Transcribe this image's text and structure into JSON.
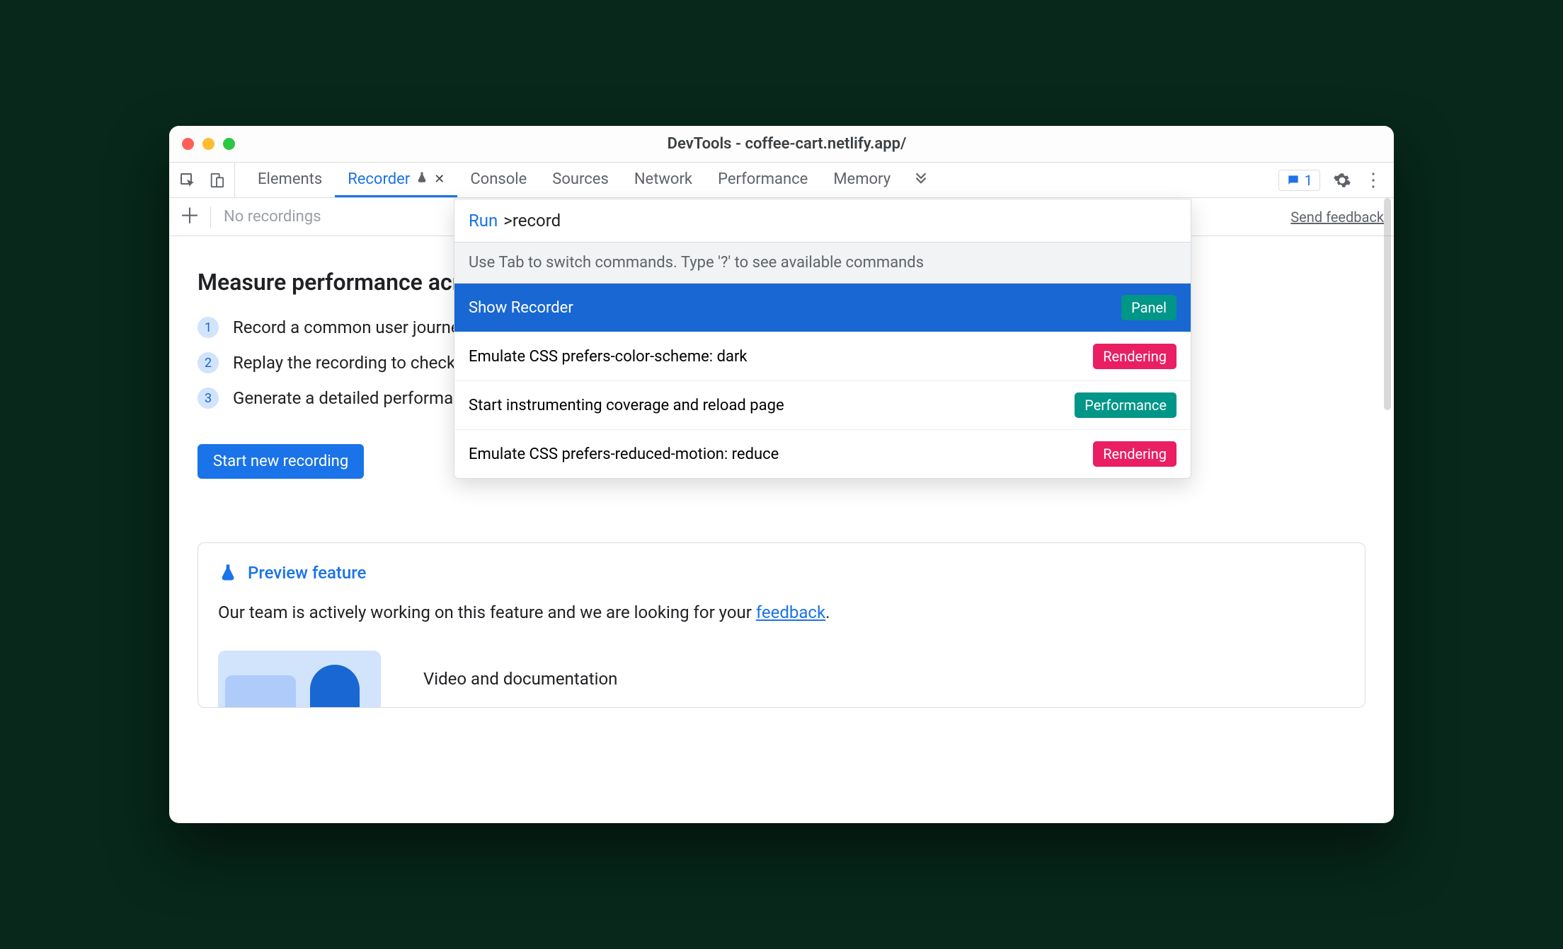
{
  "window": {
    "title": "DevTools - coffee-cart.netlify.app/"
  },
  "tabs": {
    "list": [
      "Elements",
      "Recorder",
      "Console",
      "Sources",
      "Network",
      "Performance",
      "Memory"
    ],
    "active_index": 1
  },
  "message_count": "1",
  "subbar": {
    "placeholder": "No recordings",
    "feedback": "Send feedback"
  },
  "content": {
    "heading": "Measure performance across an entire user journey",
    "steps": [
      "Record a common user journey on your website or app",
      "Replay the recording to check it works",
      "Generate a detailed performance trace"
    ],
    "button": "Start new recording"
  },
  "preview": {
    "title": "Preview feature",
    "body_prefix": "Our team is actively working on this feature and we are looking for your ",
    "feedback_word": "feedback",
    "body_suffix": ".",
    "media_label": "Video and documentation"
  },
  "command_menu": {
    "run_label": "Run",
    "query": ">record",
    "hint": "Use Tab to switch commands. Type '?' to see available commands",
    "rows": [
      {
        "text": "Show Recorder",
        "badge": "Panel",
        "badge_kind": "b-panel",
        "selected": true
      },
      {
        "text": "Emulate CSS prefers-color-scheme: dark",
        "badge": "Rendering",
        "badge_kind": "b-rendering",
        "selected": false
      },
      {
        "text": "Start instrumenting coverage and reload page",
        "badge": "Performance",
        "badge_kind": "b-performance",
        "selected": false
      },
      {
        "text": "Emulate CSS prefers-reduced-motion: reduce",
        "badge": "Rendering",
        "badge_kind": "b-rendering",
        "selected": false
      }
    ]
  }
}
